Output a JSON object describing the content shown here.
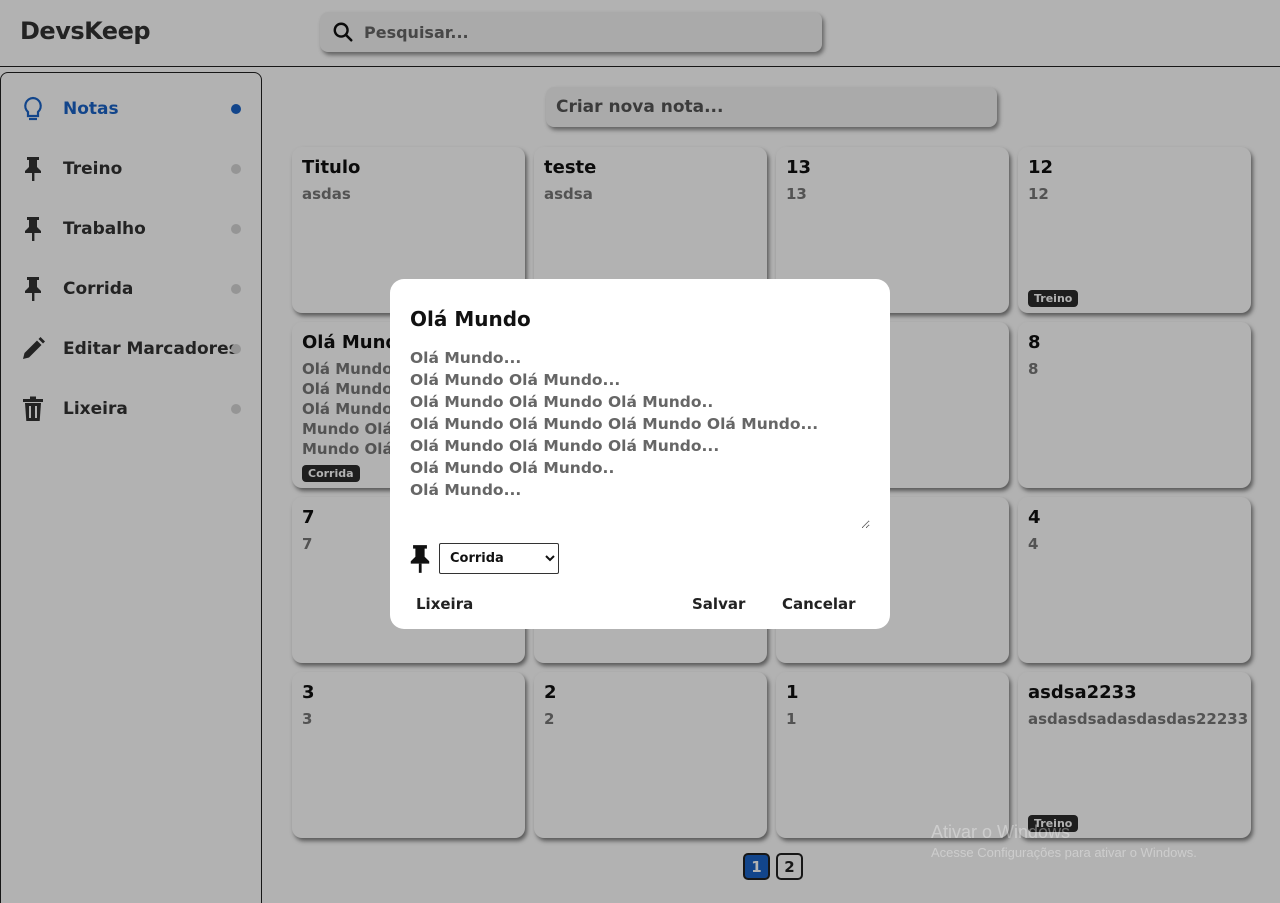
{
  "header": {
    "logo": "DevsKeep",
    "search_placeholder": "Pesquisar..."
  },
  "sidebar": {
    "items": [
      {
        "label": "Notas",
        "icon": "lightbulb-icon",
        "active": true
      },
      {
        "label": "Treino",
        "icon": "pin-icon",
        "active": false
      },
      {
        "label": "Trabalho",
        "icon": "pin-icon",
        "active": false
      },
      {
        "label": "Corrida",
        "icon": "pin-icon",
        "active": false
      },
      {
        "label": "Editar Marcadores",
        "icon": "pencil-icon",
        "active": false
      },
      {
        "label": "Lixeira",
        "icon": "trash-icon",
        "active": false
      }
    ]
  },
  "create_note": {
    "placeholder": "Criar nova nota..."
  },
  "notes": [
    {
      "title": "Titulo",
      "body": "asdas",
      "tag": ""
    },
    {
      "title": "teste",
      "body": "asdsa",
      "tag": ""
    },
    {
      "title": "13",
      "body": "13",
      "tag": ""
    },
    {
      "title": "12",
      "body": "12",
      "tag": "Treino"
    },
    {
      "title": "Olá Mundo",
      "body": "Olá Mundo.\nOlá Mundo.\nOlá Mundo\nMundo Olá\nMundo Olá",
      "tag": "Corrida"
    },
    {
      "title": "",
      "body": "",
      "tag": ""
    },
    {
      "title": "",
      "body": "",
      "tag": ""
    },
    {
      "title": "8",
      "body": "8",
      "tag": ""
    },
    {
      "title": "7",
      "body": "7",
      "tag": ""
    },
    {
      "title": "",
      "body": "",
      "tag": ""
    },
    {
      "title": "",
      "body": "",
      "tag": ""
    },
    {
      "title": "4",
      "body": "4",
      "tag": ""
    },
    {
      "title": "3",
      "body": "3",
      "tag": ""
    },
    {
      "title": "2",
      "body": "2",
      "tag": ""
    },
    {
      "title": "1",
      "body": "1",
      "tag": ""
    },
    {
      "title": "asdsa2233",
      "body": "asdasdsadasdasdas22233",
      "tag": "Treino"
    }
  ],
  "pagination": {
    "pages": [
      "1",
      "2"
    ],
    "current": "1"
  },
  "modal": {
    "title": "Olá Mundo",
    "content": "Olá Mundo...\nOlá Mundo Olá Mundo...\nOlá Mundo Olá Mundo Olá Mundo..\nOlá Mundo Olá Mundo Olá Mundo Olá Mundo...\nOlá Mundo Olá Mundo Olá Mundo...\nOlá Mundo Olá Mundo..\nOlá Mundo...",
    "selected_tag": "Corrida",
    "trash_label": "Lixeira",
    "save_label": "Salvar",
    "cancel_label": "Cancelar"
  },
  "watermark": {
    "line1": "Ativar o Windows",
    "line2": "Acesse Configurações para ativar o Windows."
  },
  "colors": {
    "accent": "#1a64c8",
    "tag_bg": "#2b2b2b",
    "overlay": "rgba(0,0,0,0.3)"
  }
}
